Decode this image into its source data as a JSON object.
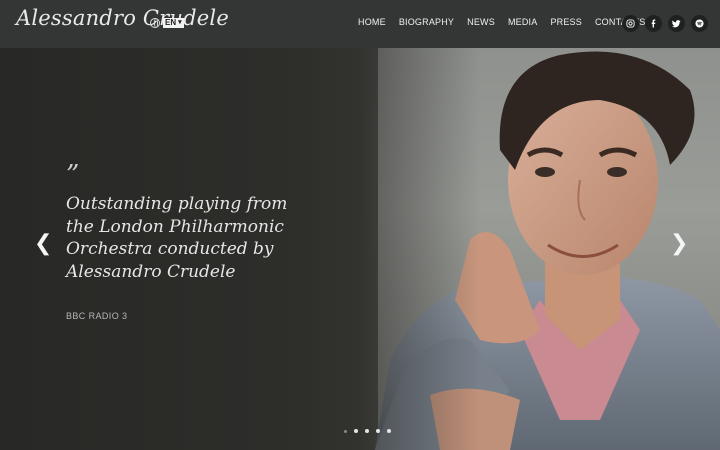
{
  "header": {
    "logo_text": "Alessandro Crudele",
    "language": "EN",
    "nav": [
      "HOME",
      "BIOGRAPHY",
      "NEWS",
      "MEDIA",
      "PRESS",
      "CONTACTS"
    ],
    "social_icons": [
      "instagram-icon",
      "facebook-icon",
      "twitter-icon",
      "spotify-icon"
    ]
  },
  "hero": {
    "quote_mark": "”",
    "quote": "Outstanding playing from the London Philharmonic Orchestra conducted by Alessandro Crudele",
    "source": "BBC RADIO 3",
    "slides": 5,
    "active_slide": 1
  },
  "colors": {
    "header_bg": "#343636",
    "text_light": "#e6e6e6"
  }
}
